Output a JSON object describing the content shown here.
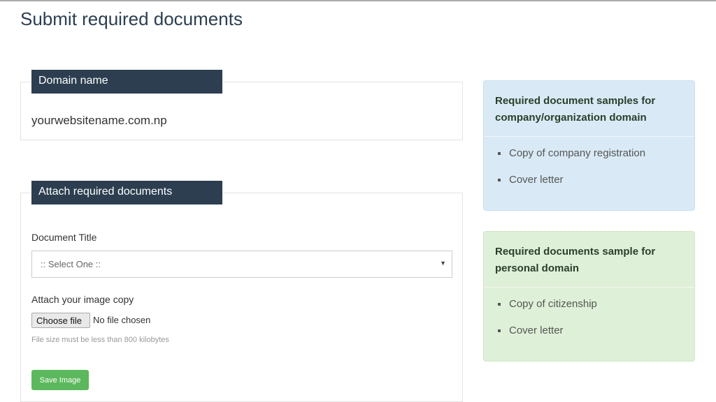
{
  "page_title": "Submit required documents",
  "domain_panel": {
    "legend": "Domain name",
    "value": "yourwebsitename.com.np"
  },
  "attach_panel": {
    "legend": "Attach required documents",
    "document_title_label": "Document Title",
    "select_value": ":: Select One ::",
    "attach_label": "Attach your image copy",
    "choose_file": "Choose file",
    "no_file": "No file chosen",
    "help": "File size must be less than 800 kilobytes",
    "save": "Save Image"
  },
  "company_box": {
    "title": "Required document samples for company/organization domain",
    "items": [
      "Copy of company registration",
      "Cover letter"
    ]
  },
  "personal_box": {
    "title": "Required documents sample for personal domain",
    "items": [
      "Copy of citizenship",
      "Cover letter"
    ]
  },
  "colors": {
    "header": "#2c3e50",
    "save": "#5cb85c",
    "info": "#d9eaf6",
    "success": "#dff0d8"
  }
}
